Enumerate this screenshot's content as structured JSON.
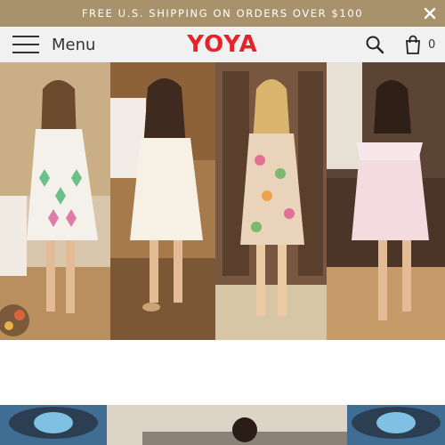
{
  "promo_bar": {
    "text": "FREE U.S. SHIPPING ON ORDERS OVER $100",
    "background": "#a8926b",
    "close_icon": "close-icon"
  },
  "header": {
    "menu_label": "Menu",
    "menu_icon": "hamburger-icon",
    "logo_text": "YOYA",
    "logo_color": "#e6232b",
    "search_icon": "search-icon",
    "cart_icon": "shopping-bag-icon",
    "cart_count": "0"
  },
  "hero": {
    "image": "collage of four girls wearing summer dresses",
    "panels": [
      "white embroidered tunic dress",
      "cream smocked dress",
      "floral print dress",
      "pink ruffled dress"
    ]
  },
  "banner": {
    "image": "colorful eye mural with child"
  }
}
